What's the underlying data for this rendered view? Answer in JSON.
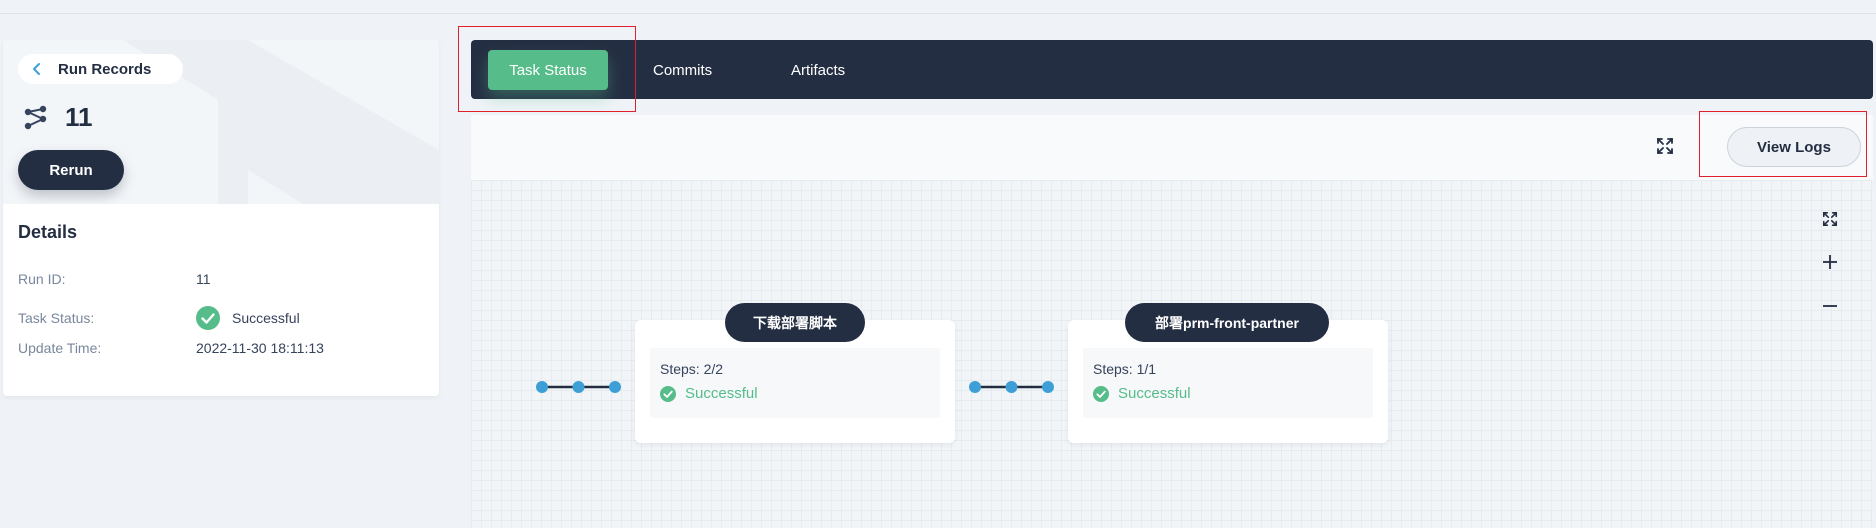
{
  "sidebar": {
    "back_label": "Run Records",
    "run_number": "11",
    "rerun_label": "Rerun",
    "details_title": "Details",
    "rows": [
      {
        "key": "Run ID:",
        "value": "11"
      },
      {
        "key": "Task Status:",
        "value": "Successful"
      },
      {
        "key": "Update Time:",
        "value": "2022-11-30 18:11:13"
      }
    ]
  },
  "tabs": [
    {
      "label": "Task Status",
      "active": true
    },
    {
      "label": "Commits",
      "active": false
    },
    {
      "label": "Artifacts",
      "active": false
    }
  ],
  "toolbar": {
    "view_logs_label": "View Logs"
  },
  "pipeline": {
    "stages": [
      {
        "name": "下载部署脚本",
        "steps": "Steps: 2/2",
        "status": "Successful"
      },
      {
        "name": "部署prm-front-partner",
        "steps": "Steps: 1/1",
        "status": "Successful"
      }
    ]
  },
  "colors": {
    "dark": "#242e42",
    "success": "#55bc8a",
    "connector_dot": "#3d9fd6",
    "highlight": "#e0212c"
  },
  "icons": [
    "chevron-left-icon",
    "pipeline-icon",
    "check-circle-icon",
    "fullscreen-icon",
    "zoom-in-icon",
    "zoom-out-icon"
  ]
}
